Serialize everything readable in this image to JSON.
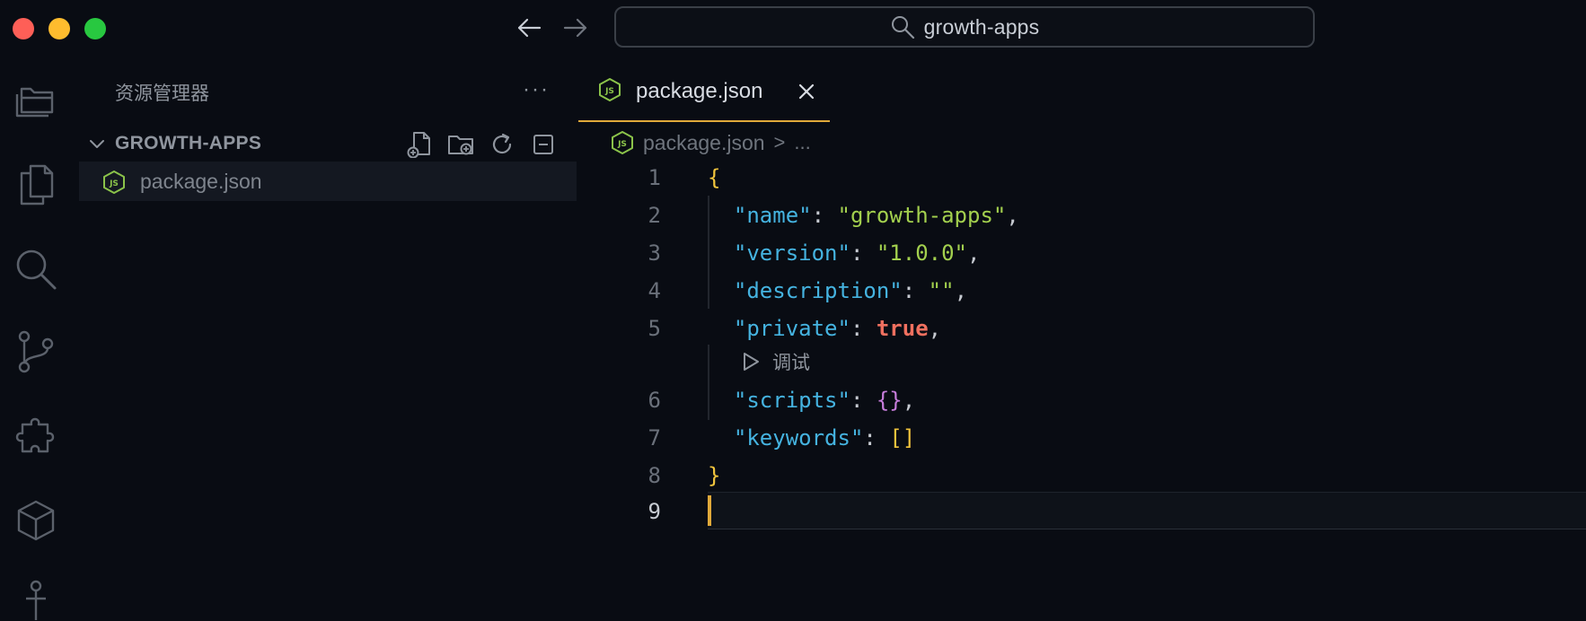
{
  "titlebar": {
    "search_text": "growth-apps"
  },
  "sidebar": {
    "title": "资源管理器",
    "more": "···",
    "section_label": "GROWTH-APPS",
    "files": [
      {
        "name": "package.json"
      }
    ]
  },
  "editor": {
    "tab_label": "package.json",
    "breadcrumb": {
      "file": "package.json",
      "separator": ">",
      "rest": "..."
    },
    "codelens_label": "调试",
    "line_numbers": [
      "1",
      "2",
      "3",
      "4",
      "5",
      "6",
      "7",
      "8",
      "9"
    ],
    "code": {
      "l1": {
        "brace": "{"
      },
      "l2": {
        "key": "\"name\"",
        "colon": ": ",
        "value": "\"growth-apps\"",
        "comma": ","
      },
      "l3": {
        "key": "\"version\"",
        "colon": ": ",
        "value": "\"1.0.0\"",
        "comma": ","
      },
      "l4": {
        "key": "\"description\"",
        "colon": ": ",
        "value": "\"\"",
        "comma": ","
      },
      "l5": {
        "key": "\"private\"",
        "colon": ": ",
        "value": "true",
        "comma": ","
      },
      "l6": {
        "key": "\"scripts\"",
        "colon": ": ",
        "value": "{}",
        "comma": ","
      },
      "l7": {
        "key": "\"keywords\"",
        "colon": ": ",
        "value": "[]"
      },
      "l8": {
        "brace": "}"
      }
    }
  },
  "colors": {
    "background": "#090c13",
    "accent": "#e0a93a",
    "json_key": "#45b3e0",
    "json_string": "#a3d04e",
    "json_boolean": "#f0705f",
    "json_brace": "#f2c53d",
    "json_object": "#c77ddb",
    "file_icon": "#8bc34a"
  },
  "icons": {
    "search": "search-icon",
    "explorer": "folder-icon",
    "files": "files-icon",
    "scm": "source-control-icon",
    "extensions": "puzzle-icon",
    "remote": "cube-icon",
    "anchor": "anchor-icon",
    "json_file": "nodejs-file-icon"
  }
}
